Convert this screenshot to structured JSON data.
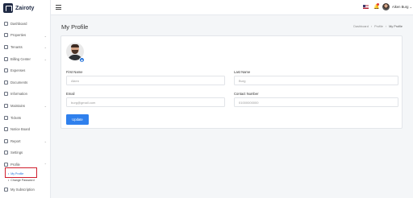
{
  "brand": {
    "name": "Zairoty"
  },
  "sidebar": {
    "items": [
      {
        "label": "Dashboard",
        "chev": ""
      },
      {
        "label": "Properties",
        "chev": "⌄"
      },
      {
        "label": "Tenants",
        "chev": "⌄"
      },
      {
        "label": "Billing Center",
        "chev": "⌄"
      },
      {
        "label": "Expenses",
        "chev": ""
      },
      {
        "label": "Documents",
        "chev": ""
      },
      {
        "label": "Information",
        "chev": ""
      },
      {
        "label": "Maintains",
        "chev": "⌄"
      },
      {
        "label": "Tickets",
        "chev": ""
      },
      {
        "label": "Notice Board",
        "chev": ""
      },
      {
        "label": "Report",
        "chev": "⌄"
      },
      {
        "label": "Settings",
        "chev": ""
      },
      {
        "label": "Profile",
        "chev": "⌃"
      }
    ],
    "profile_sub": [
      {
        "label": "My Profile"
      },
      {
        "label": "Change Password"
      }
    ],
    "after": {
      "label": "My Subscription"
    }
  },
  "topbar": {
    "user_name": "Aiken Burg ⌄"
  },
  "page": {
    "title": "My Profile",
    "breadcrumb": [
      "Dashboard",
      "Profile",
      "My Profile"
    ]
  },
  "form": {
    "first_name_label": "First Name",
    "first_name_value": "Aiken",
    "last_name_label": "Last Name",
    "last_name_value": "Burg",
    "email_label": "Email",
    "email_value": "burg@gmail.com",
    "contact_label": "Contact Number",
    "contact_value": "01000000000",
    "update_label": "Update"
  },
  "colors": {
    "accent": "#2f80ed",
    "highlight": "#d01f2e"
  }
}
